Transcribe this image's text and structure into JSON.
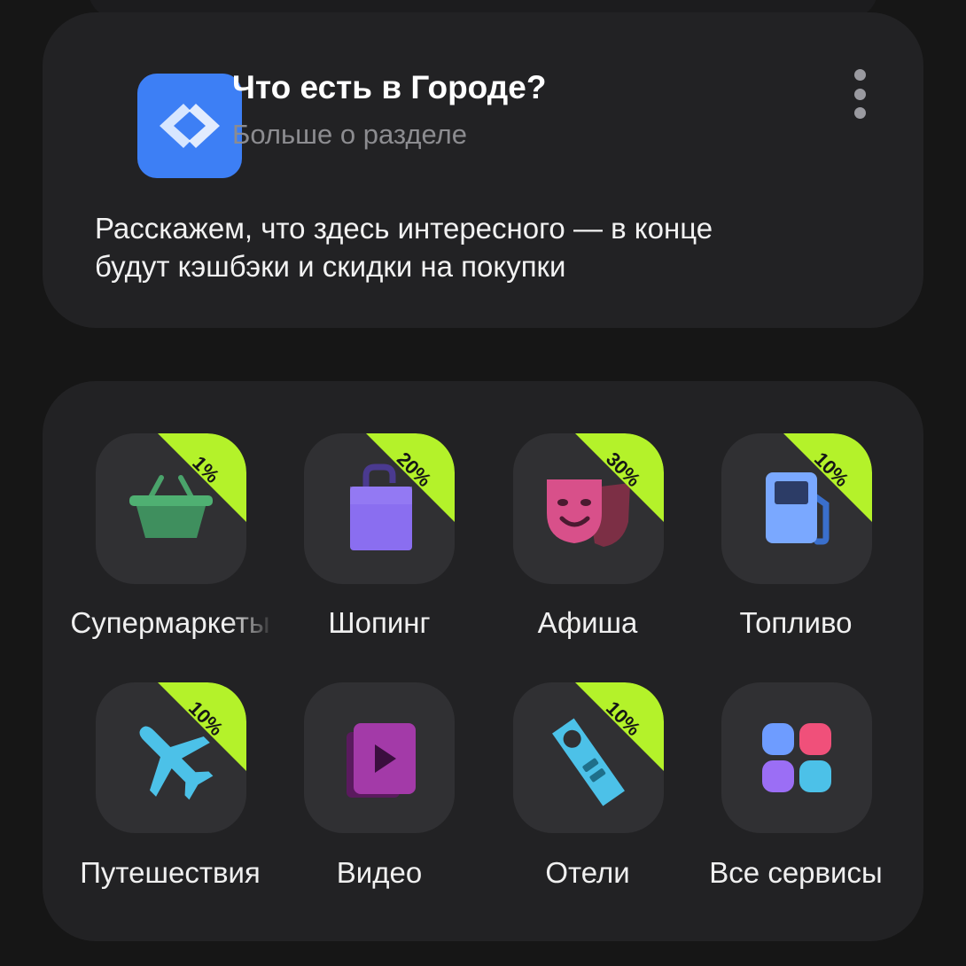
{
  "promo": {
    "title": "Что есть в Городе?",
    "subtitle": "Больше о разделе",
    "description_lines": [
      "Расскажем, что здесь интересного — в конце",
      "будут кэшбэки и скидки на покупки"
    ],
    "icon": "diamond-arrows-icon",
    "menu_icon": "more-vertical-icon"
  },
  "services": [
    {
      "label": "Супермаркеты",
      "badge": "1%",
      "icon": "basket-icon"
    },
    {
      "label": "Шопинг",
      "badge": "20%",
      "icon": "shopping-bag-icon"
    },
    {
      "label": "Афиша",
      "badge": "30%",
      "icon": "theater-masks-icon"
    },
    {
      "label": "Топливо",
      "badge": "10%",
      "icon": "fuel-pump-icon"
    },
    {
      "label": "Путешествия",
      "badge": "10%",
      "icon": "airplane-icon"
    },
    {
      "label": "Видео",
      "badge": "",
      "icon": "video-play-icon"
    },
    {
      "label": "Отели",
      "badge": "10%",
      "icon": "door-hanger-icon"
    },
    {
      "label": "Все сервисы",
      "badge": "",
      "icon": "grid-icon"
    }
  ],
  "colors": {
    "background": "#161616",
    "card": "#222224",
    "tile": "#303033",
    "badge": "#b4f22a",
    "app_icon": "#3d7ff5"
  }
}
